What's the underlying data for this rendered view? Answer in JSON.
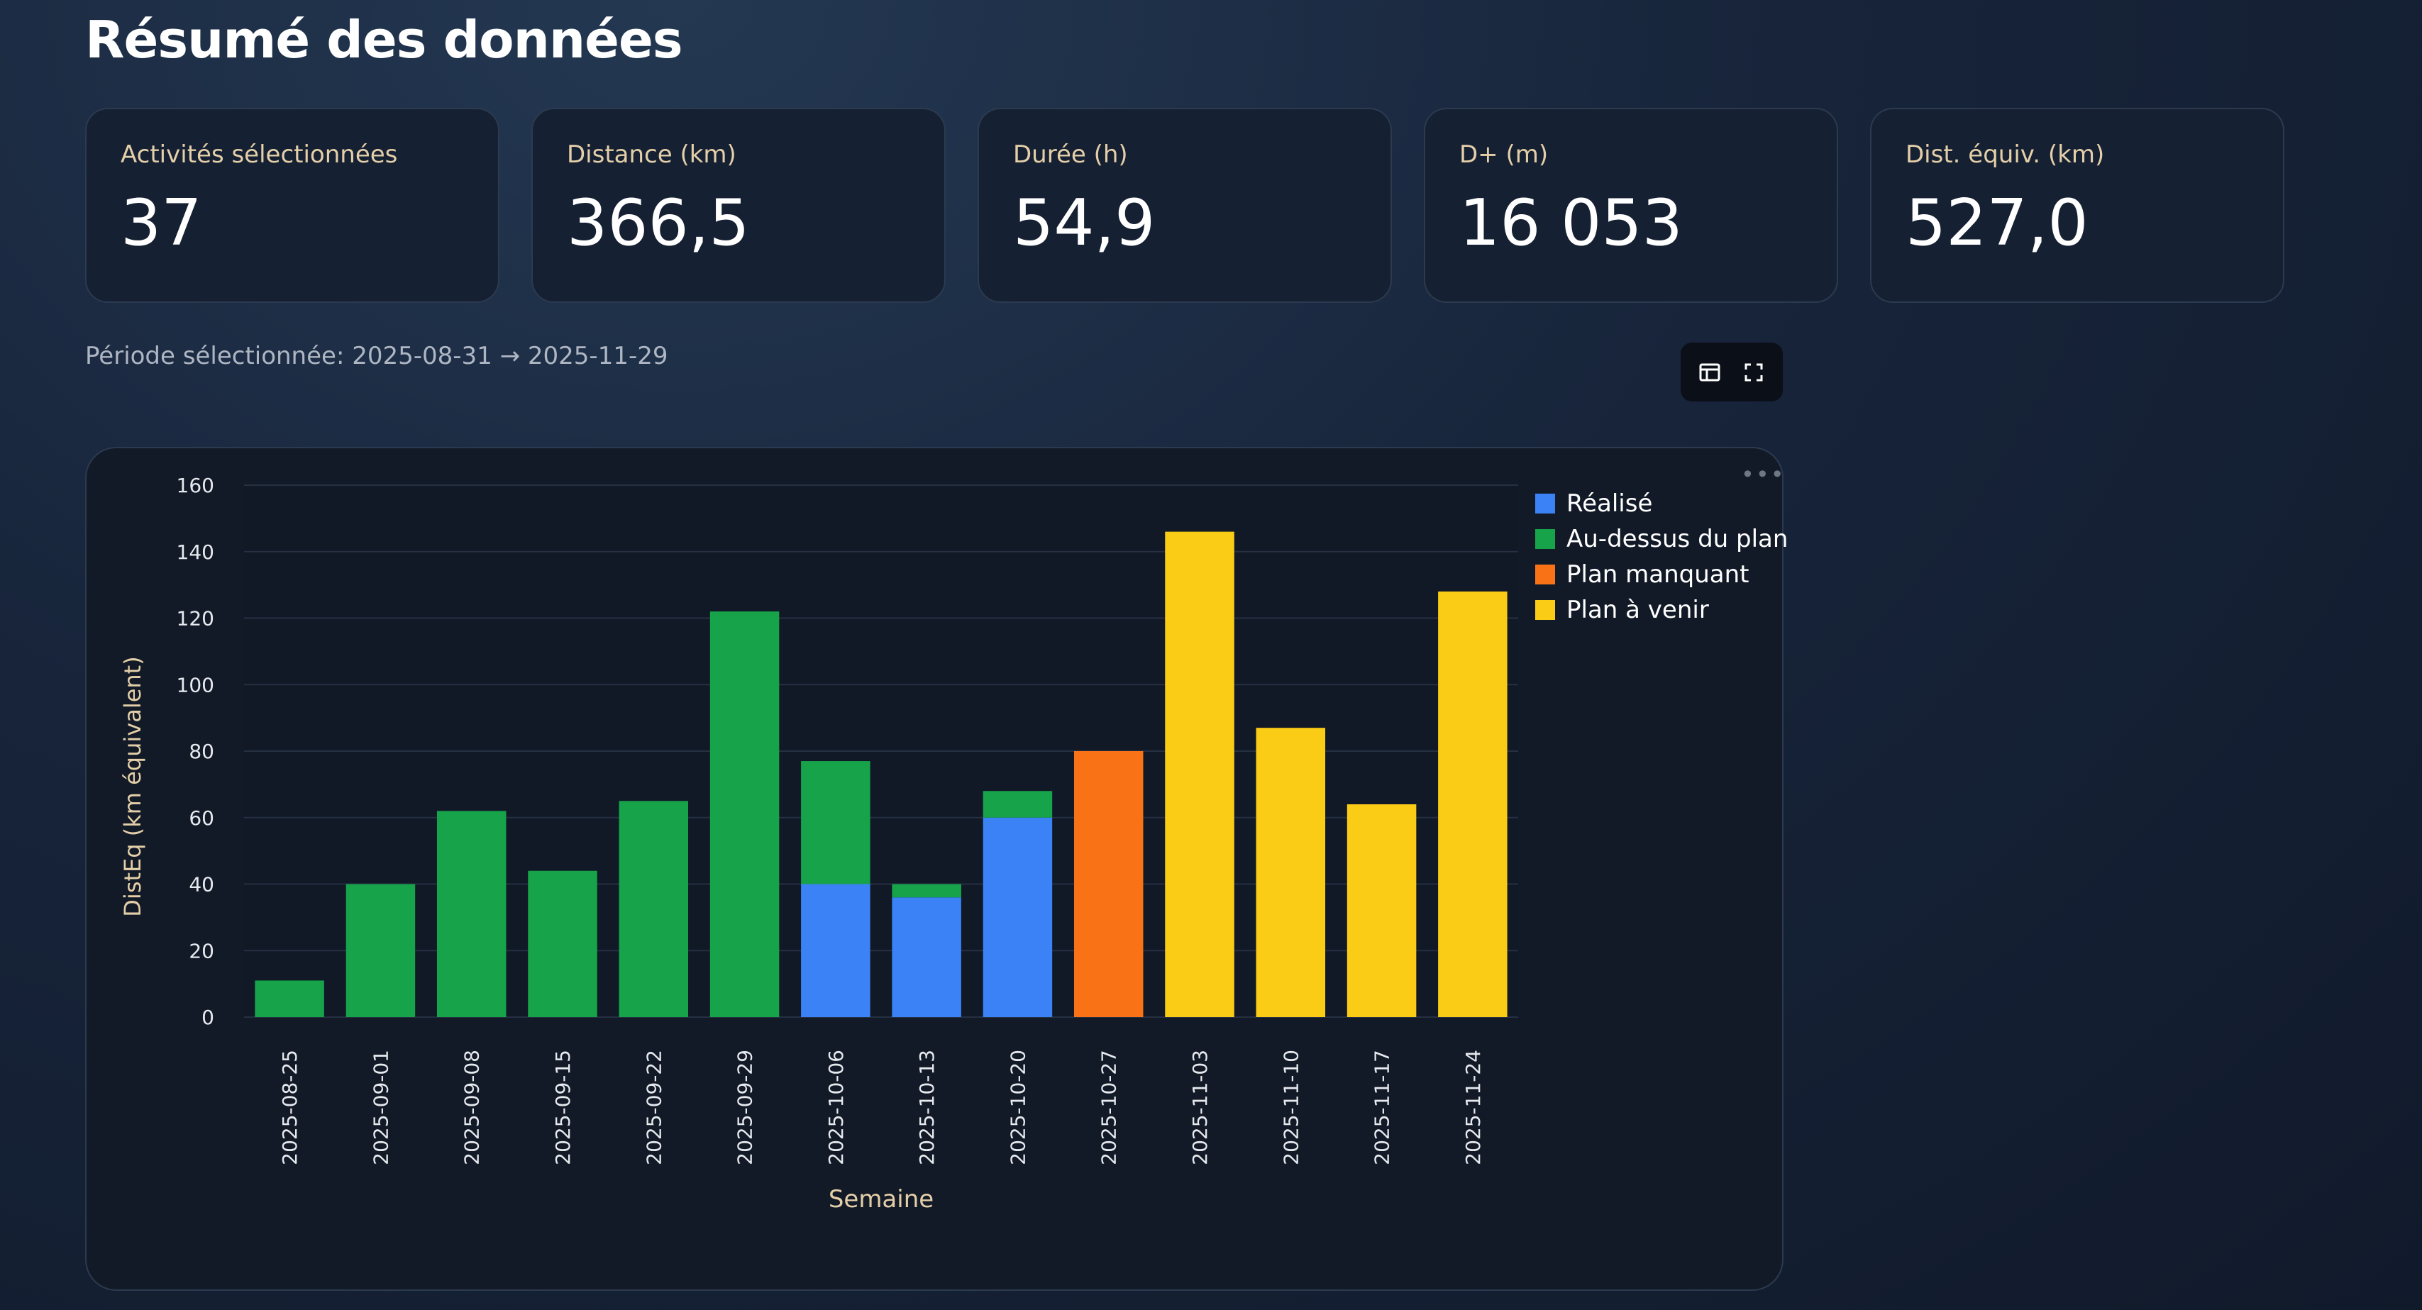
{
  "page": {
    "title": "Résumé des données",
    "period": "Période sélectionnée: 2025-08-31 → 2025-11-29"
  },
  "metrics": [
    {
      "label": "Activités sélectionnées",
      "value": "37"
    },
    {
      "label": "Distance (km)",
      "value": "366,5"
    },
    {
      "label": "Durée (h)",
      "value": "54,9"
    },
    {
      "label": "D+ (m)",
      "value": "16 053"
    },
    {
      "label": "Dist. équiv. (km)",
      "value": "527,0"
    }
  ],
  "toolbar": {
    "icons": [
      "table-icon",
      "fullscreen-icon"
    ],
    "menu_icon": "more-options-icon"
  },
  "colors": {
    "realise": "#3b82f6",
    "au_dessus": "#16a34a",
    "manquant": "#f97316",
    "a_venir": "#facc15",
    "axis_title": "#e4cfa8"
  },
  "chart_data": {
    "type": "bar",
    "stacked": true,
    "xlabel": "Semaine",
    "ylabel": "DistEq (km équivalent)",
    "ylim": [
      0,
      160
    ],
    "yticks": [
      0,
      20,
      40,
      60,
      80,
      100,
      120,
      140,
      160
    ],
    "grid": true,
    "legend_position": "top-right",
    "categories": [
      "2025-08-25",
      "2025-09-01",
      "2025-09-08",
      "2025-09-15",
      "2025-09-22",
      "2025-09-29",
      "2025-10-06",
      "2025-10-13",
      "2025-10-20",
      "2025-10-27",
      "2025-11-03",
      "2025-11-10",
      "2025-11-17",
      "2025-11-24"
    ],
    "series": [
      {
        "name": "Réalisé",
        "color": "#3b82f6",
        "values": [
          0,
          0,
          0,
          0,
          0,
          0,
          40,
          36,
          60,
          0,
          0,
          0,
          0,
          0
        ]
      },
      {
        "name": "Au-dessus du plan",
        "color": "#16a34a",
        "values": [
          11,
          40,
          62,
          44,
          65,
          122,
          37,
          4,
          8,
          0,
          0,
          0,
          0,
          0
        ]
      },
      {
        "name": "Plan manquant",
        "color": "#f97316",
        "values": [
          0,
          0,
          0,
          0,
          0,
          0,
          0,
          0,
          0,
          80,
          0,
          0,
          0,
          0
        ]
      },
      {
        "name": "Plan à venir",
        "color": "#facc15",
        "values": [
          0,
          0,
          0,
          0,
          0,
          0,
          0,
          0,
          0,
          0,
          146,
          87,
          64,
          128
        ]
      }
    ]
  }
}
